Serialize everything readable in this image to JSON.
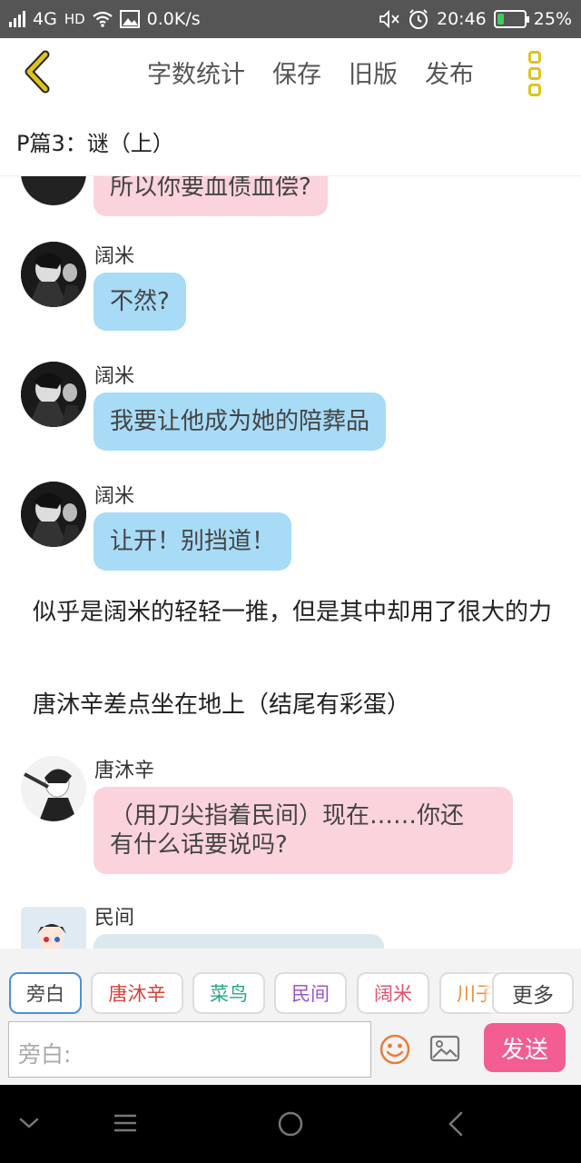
{
  "status_bar": {
    "network": "4G",
    "hd": "HD",
    "speed": "0.0K/s",
    "time": "20:46",
    "battery": "25%",
    "battery_level": 0.25
  },
  "toolbar": {
    "back_icon": "chevron-left-icon",
    "items": [
      "字数统计",
      "保存",
      "旧版",
      "发布"
    ],
    "more_icon": "kebab-menu-icon",
    "accent": "#e0c319"
  },
  "title": "P篇3：谜（上）",
  "messages": {
    "m0": {
      "text": "所以你要血债血偿?"
    },
    "m1": {
      "sender": "阔米",
      "text": "不然?"
    },
    "m2": {
      "sender": "阔米",
      "text": "我要让他成为她的陪葬品"
    },
    "m3": {
      "sender": "阔米",
      "text": "让开！别挡道！"
    },
    "n1": "似乎是阔米的轻轻一推，但是其中却用了很大的力",
    "n2": "唐沐辛差点坐在地上（结尾有彩蛋）",
    "m4": {
      "sender": "唐沐辛",
      "line1": "（用刀尖指着民间）现在……你还",
      "line2": "有什么话要说吗?"
    },
    "m5": {
      "sender": "民间"
    }
  },
  "characters": {
    "c0": {
      "label": "旁白",
      "color": "#444444"
    },
    "c1": {
      "label": "唐沐辛",
      "color": "#d9403a"
    },
    "c2": {
      "label": "菜鸟",
      "color": "#2aa38a"
    },
    "c3": {
      "label": "民间",
      "color": "#9a55c8"
    },
    "c4": {
      "label": "阔米",
      "color": "#e2506c"
    },
    "c5": {
      "label": "川子",
      "color": "#e88a3a"
    },
    "more": "更多"
  },
  "input": {
    "placeholder": "旁白:",
    "emoji_icon": "smiley-icon",
    "image_icon": "image-icon",
    "send_label": "发送",
    "send_color": "#f35d92"
  },
  "bubble_colors": {
    "blue": "#a8dbf6",
    "pink": "#fbd3dc"
  }
}
